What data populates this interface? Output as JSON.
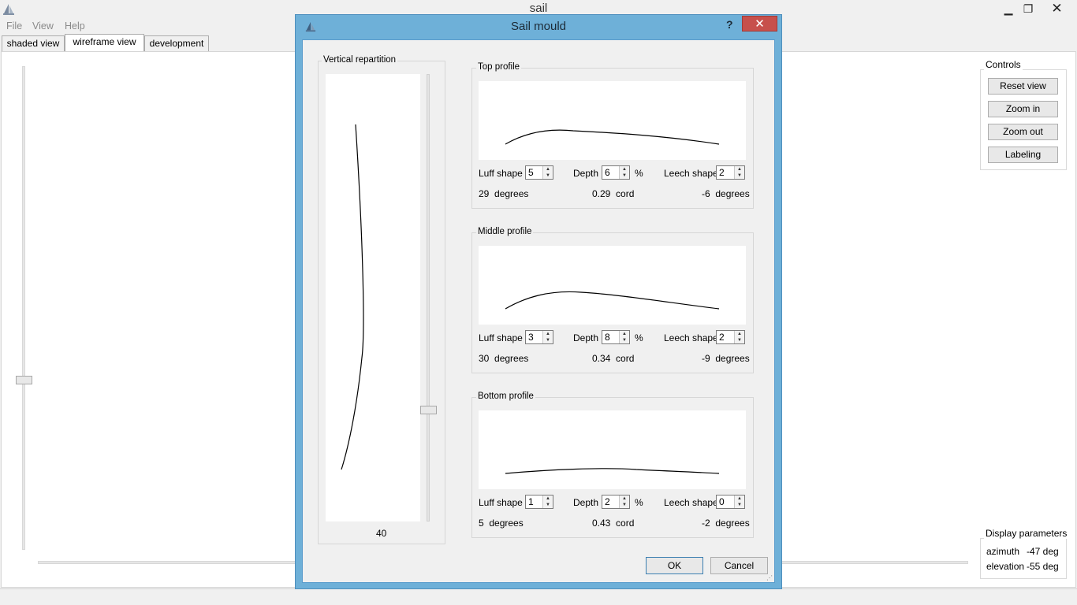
{
  "window": {
    "title": "sail",
    "controls": {
      "minimize": "▁",
      "maximize": "❐",
      "close": "✕"
    }
  },
  "menu": [
    "File",
    "View",
    "Help"
  ],
  "tabs": [
    {
      "label": "shaded view",
      "active": false
    },
    {
      "label": "wireframe view",
      "active": true
    },
    {
      "label": "development",
      "active": false
    }
  ],
  "controls_panel": {
    "title": "Controls",
    "buttons": [
      "Reset view",
      "Zoom in",
      "Zoom out",
      "Labeling"
    ]
  },
  "display_parameters": {
    "title": "Display parameters",
    "azimuth_label": "azimuth",
    "azimuth_value": "-47 deg",
    "elevation_label": "elevation",
    "elevation_value": "-55 deg"
  },
  "dialog": {
    "title": "Sail mould",
    "help": "?",
    "close": "✕",
    "vertical": {
      "title": "Vertical repartition",
      "value": "40",
      "slider_fraction": 0.75
    },
    "profiles": [
      {
        "title": "Top profile",
        "luff_label": "Luff shape",
        "luff_value": "5",
        "depth_label": "Depth",
        "depth_value": "6",
        "pct": "%",
        "leech_label": "Leech shape",
        "leech_value": "2",
        "luff_angle": "29",
        "cord_value": "0.29",
        "leech_angle": "-6",
        "deg": "degrees",
        "cord": "cord"
      },
      {
        "title": "Middle profile",
        "luff_label": "Luff shape",
        "luff_value": "3",
        "depth_label": "Depth",
        "depth_value": "8",
        "pct": "%",
        "leech_label": "Leech shape",
        "leech_value": "2",
        "luff_angle": "30",
        "cord_value": "0.34",
        "leech_angle": "-9",
        "deg": "degrees",
        "cord": "cord"
      },
      {
        "title": "Bottom profile",
        "luff_label": "Luff shape",
        "luff_value": "1",
        "depth_label": "Depth",
        "depth_value": "2",
        "pct": "%",
        "leech_label": "Leech shape",
        "leech_value": "0",
        "luff_angle": "5",
        "cord_value": "0.43",
        "leech_angle": "-2",
        "deg": "degrees",
        "cord": "cord"
      }
    ],
    "ok": "OK",
    "cancel": "Cancel"
  }
}
